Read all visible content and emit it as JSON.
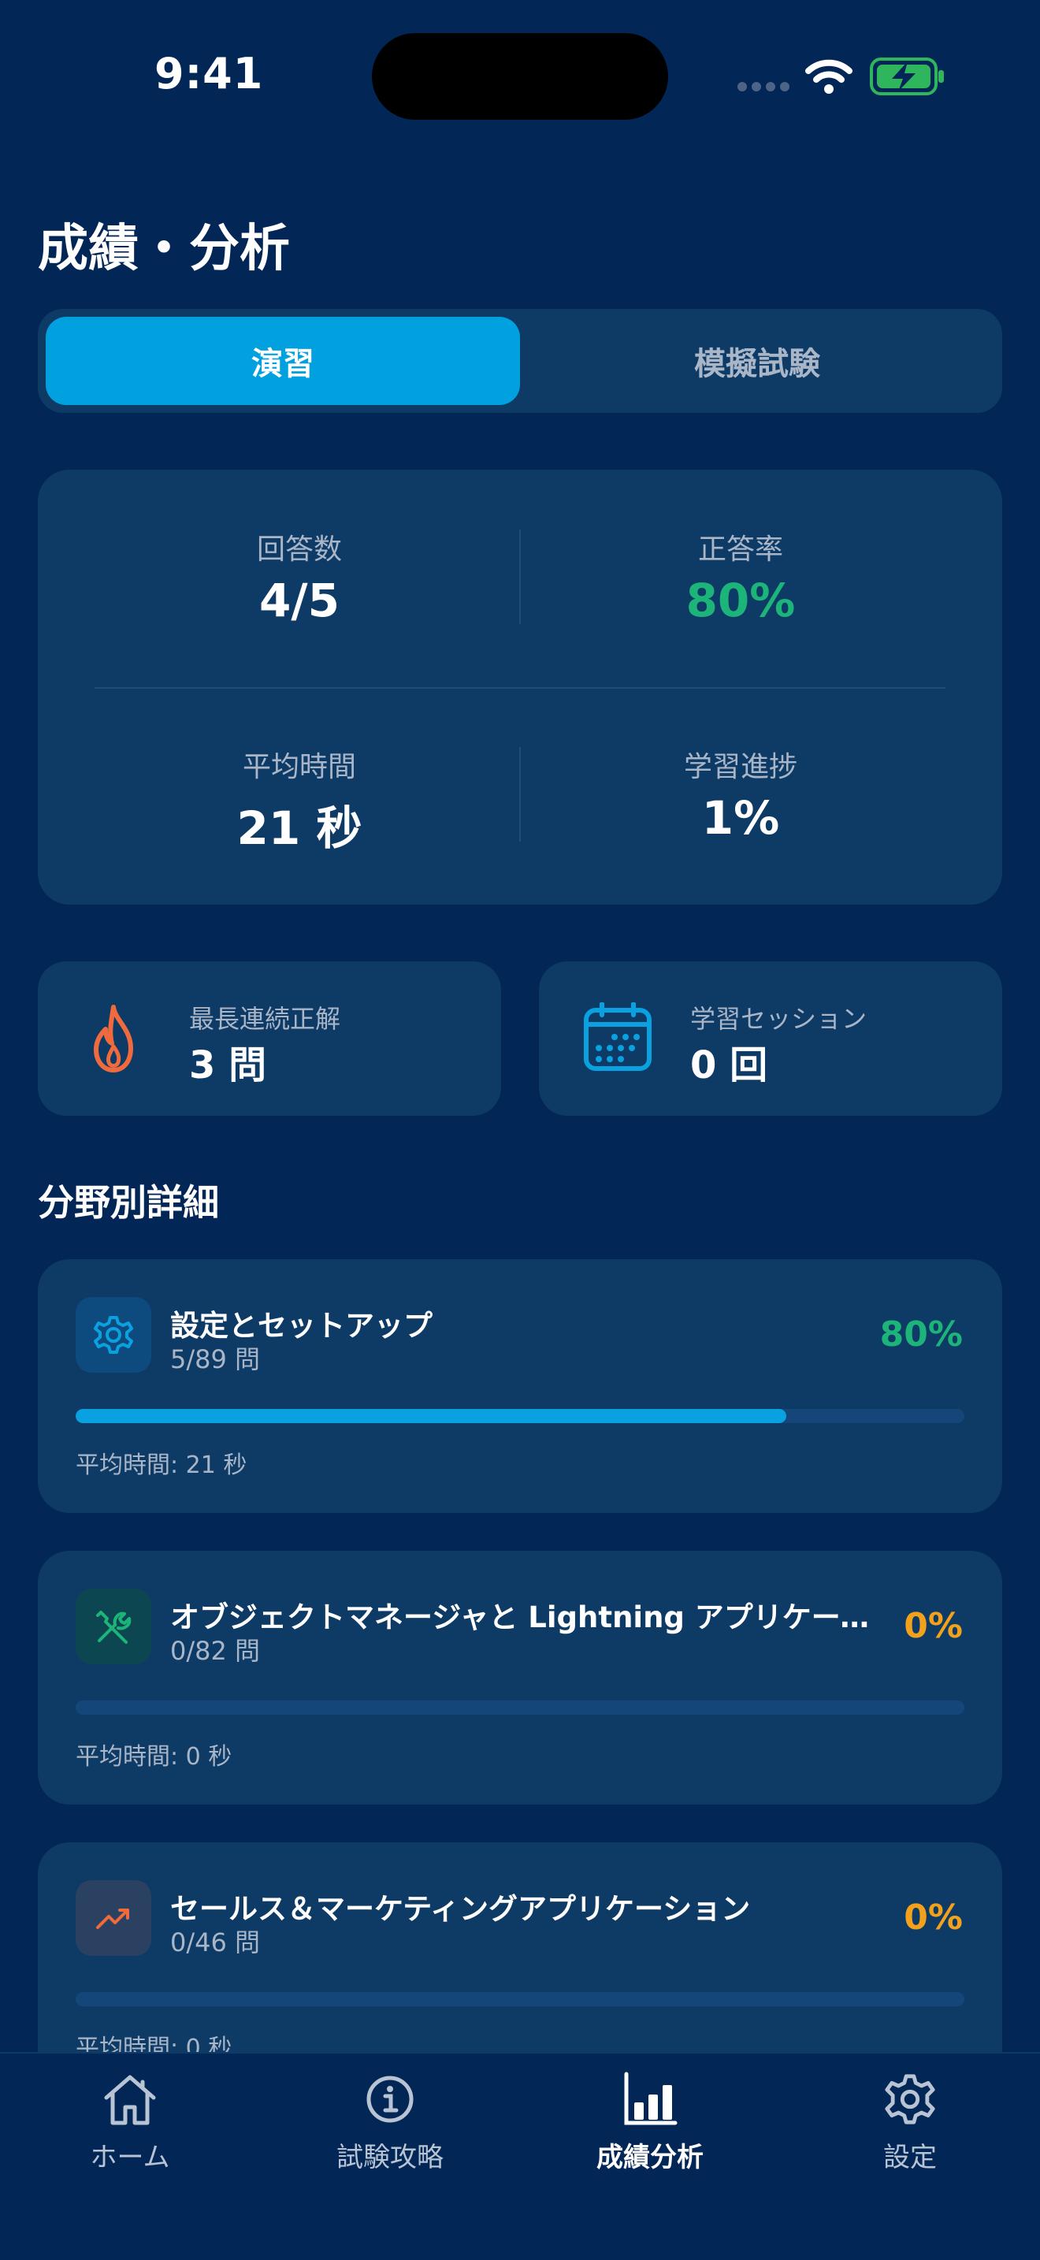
{
  "status_bar": {
    "time": "9:41"
  },
  "page_title": "成績・分析",
  "segments": {
    "active": "演習",
    "inactive": "模擬試験"
  },
  "summary": {
    "answered_label": "回答数",
    "answered_value": "4/5",
    "accuracy_label": "正答率",
    "accuracy_value": "80%",
    "avg_time_label": "平均時間",
    "avg_time_value": "21 秒",
    "progress_label": "学習進捗",
    "progress_value": "1%"
  },
  "streak": {
    "label": "最長連続正解",
    "value": "3 問",
    "icon": "flame-icon"
  },
  "sessions": {
    "label": "学習セッション",
    "value": "0 回",
    "icon": "calendar-icon"
  },
  "section_title": "分野別詳細",
  "categories": [
    {
      "title": "設定とセットアップ",
      "count": "5/89 問",
      "percent": "80%",
      "progress": 0.8,
      "avg": "平均時間: 21 秒",
      "icon": "gear-icon",
      "color": "#1db47a"
    },
    {
      "title": "オブジェクトマネージャと Lightning アプリケーショ…",
      "count": "0/82 問",
      "percent": "0%",
      "progress": 0,
      "avg": "平均時間: 0 秒",
      "icon": "tools-icon",
      "color": "#f2a11c"
    },
    {
      "title": "セールス＆マーケティングアプリケーション",
      "count": "0/46 問",
      "percent": "0%",
      "progress": 0,
      "avg": "平均時間: 0 秒",
      "icon": "trend-up-icon",
      "color": "#f2a11c"
    }
  ],
  "tabbar": [
    {
      "label": "ホーム",
      "icon": "home-icon"
    },
    {
      "label": "試験攻略",
      "icon": "info-icon"
    },
    {
      "label": "成績分析",
      "icon": "bar-chart-icon",
      "active": true
    },
    {
      "label": "設定",
      "icon": "gear-icon"
    }
  ]
}
